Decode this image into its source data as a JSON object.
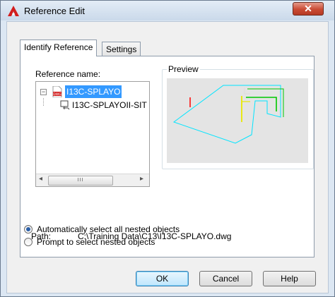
{
  "window": {
    "title": "Reference Edit",
    "close_glyph": "✕"
  },
  "tabs": [
    {
      "label": "Identify Reference",
      "active": true
    },
    {
      "label": "Settings",
      "active": false
    }
  ],
  "reference": {
    "label": "Reference name:",
    "items": [
      {
        "label": "I13C-SPLAYO",
        "icon": "dwg-file-icon",
        "selected": true,
        "expanded": true,
        "expander_glyph": "−"
      },
      {
        "label": "I13C-SPLAYOII-SIT",
        "icon": "xref-icon",
        "selected": false
      }
    ],
    "scroll_left_glyph": "◂",
    "scroll_right_glyph": "▸",
    "scroll_thumb_grip": "III"
  },
  "preview": {
    "label": "Preview"
  },
  "path": {
    "label": "Path:",
    "value": "C:\\Training Data\\C13\\I13C-SPLAYO.dwg"
  },
  "options": [
    {
      "label": "Automatically select all nested objects",
      "checked": true
    },
    {
      "label": "Prompt to select nested objects",
      "checked": false
    }
  ],
  "buttons": {
    "ok": "OK",
    "cancel": "Cancel",
    "help": "Help"
  },
  "colors": {
    "accent": "#3399ff",
    "title_bg": "#dce7f3",
    "close": "#c94a33",
    "preview_cyan": "#00e5ff",
    "preview_green": "#00c800",
    "preview_yellow": "#e8e800",
    "preview_red": "#ff0000"
  }
}
